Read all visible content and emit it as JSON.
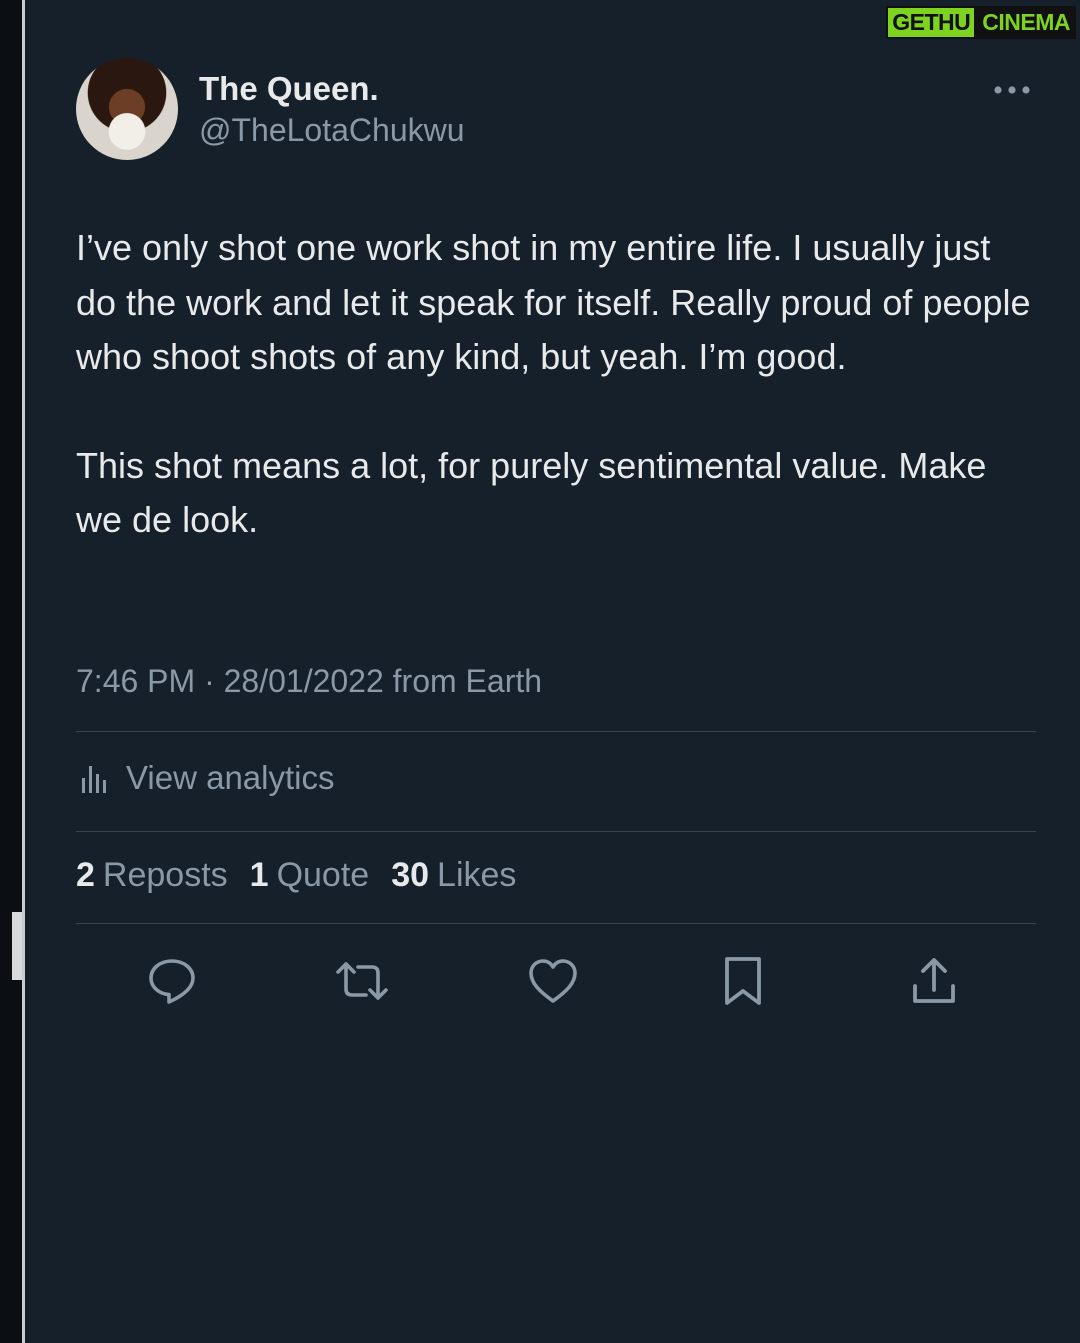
{
  "watermark": {
    "part1": "GETHU",
    "part2": "CINEMA"
  },
  "author": {
    "display_name": "The Queen.",
    "handle": "@TheLotaChukwu"
  },
  "tweet": {
    "paragraph1": "I’ve only shot one work shot in my entire life. I usually just do the work and let it speak for itself. Really proud of people who shoot shots of any kind, but yeah. I’m good.",
    "paragraph2": "This shot means a lot, for purely sentimental value. Make we de look.",
    "timestamp": "7:46 PM · 28/01/2022 from Earth"
  },
  "analytics": {
    "label": "View analytics",
    "icon": "bar-chart-icon"
  },
  "stats": {
    "reposts_count": "2",
    "reposts_label": "Reposts",
    "quotes_count": "1",
    "quotes_label": "Quote",
    "likes_count": "30",
    "likes_label": "Likes"
  },
  "actions": [
    {
      "name": "reply",
      "icon": "reply-icon"
    },
    {
      "name": "repost",
      "icon": "repost-icon"
    },
    {
      "name": "like",
      "icon": "heart-icon"
    },
    {
      "name": "bookmark",
      "icon": "bookmark-icon"
    },
    {
      "name": "share",
      "icon": "share-icon"
    }
  ],
  "colors": {
    "background": "#15202b",
    "primary_text": "#e7e9ea",
    "secondary_text": "#8b98a5",
    "divider": "#38444d",
    "watermark_green": "#7ed321"
  }
}
